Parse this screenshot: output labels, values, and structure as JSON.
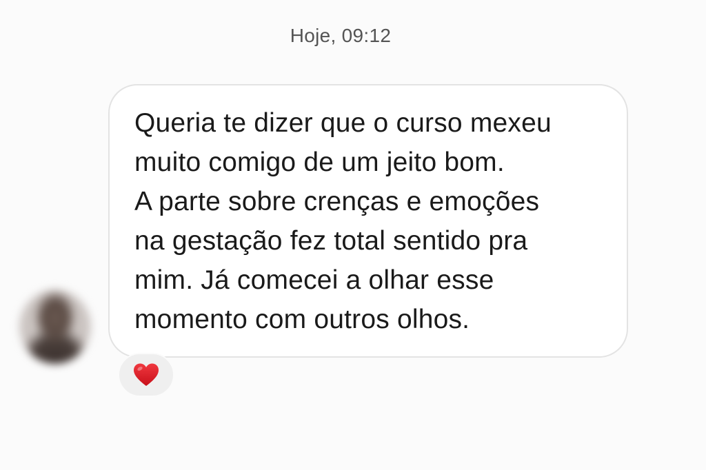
{
  "timestamp": "Hoje, 09:12",
  "message": {
    "text": "Queria te dizer que o curso mexeu\nmuito comigo de um jeito bom.\nA parte sobre crenças e emoções\nna gestação fez total sentido pra\nmim. Já comecei a olhar esse\nmomento com outros olhos."
  },
  "reaction": {
    "icon": "heart-icon",
    "color": "#e0141c"
  },
  "colors": {
    "background": "#fbfbfb",
    "bubble_border": "#e3e3e3",
    "reaction_bg": "#efefef"
  }
}
